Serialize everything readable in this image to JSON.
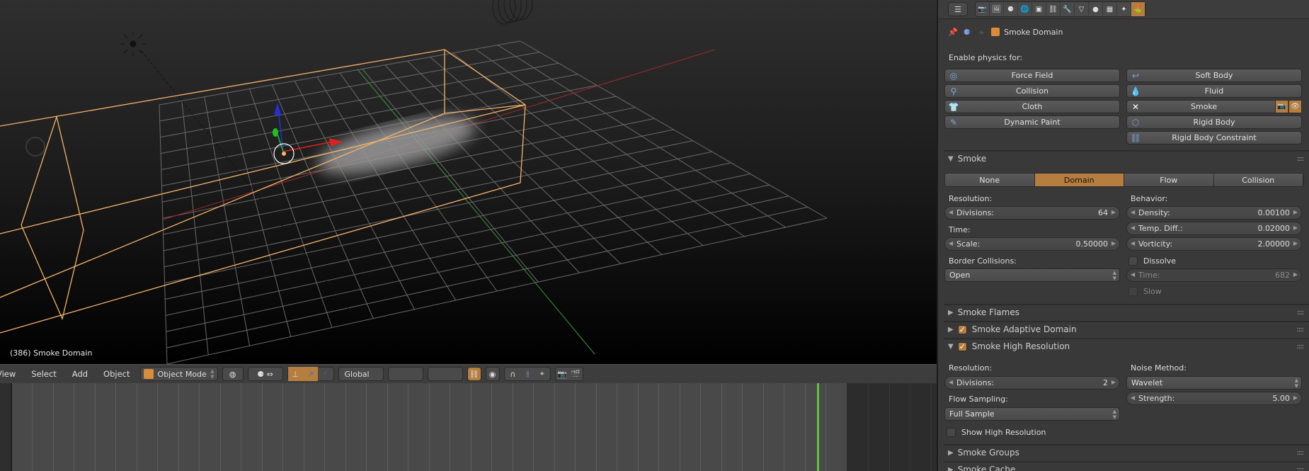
{
  "viewport": {
    "object_label": "(386) Smoke Domain",
    "menu": [
      "View",
      "Select",
      "Add",
      "Object"
    ],
    "mode": "Object Mode",
    "orientation": "Global",
    "colors": {
      "selection_outline": "#f5b46a",
      "grid": "#6a6a6a",
      "x_axis": "#a52a2a",
      "y_axis": "#3a9a3a"
    }
  },
  "timeline": {
    "current_frame_color": "#5fc43a"
  },
  "properties": {
    "breadcrumb": {
      "object": "Smoke Domain"
    },
    "context_tabs": [
      "render",
      "render-layers",
      "scene",
      "world",
      "object",
      "constraints",
      "modifiers",
      "data",
      "material",
      "texture",
      "particles",
      "physics"
    ],
    "active_tab": "physics",
    "enable_physics_label": "Enable physics for:",
    "physics_buttons_left": [
      {
        "label": "Force Field",
        "icon": "force-field-icon"
      },
      {
        "label": "Collision",
        "icon": "collision-icon"
      },
      {
        "label": "Cloth",
        "icon": "cloth-icon"
      },
      {
        "label": "Dynamic Paint",
        "icon": "dynamic-paint-icon"
      }
    ],
    "physics_buttons_right": [
      {
        "label": "Soft Body",
        "icon": "soft-body-icon"
      },
      {
        "label": "Fluid",
        "icon": "fluid-icon"
      },
      {
        "label": "Smoke",
        "icon": "close-icon"
      },
      {
        "label": "Rigid Body",
        "icon": "rigid-body-icon"
      },
      {
        "label": "Rigid Body Constraint",
        "icon": "chain-link-icon"
      }
    ],
    "smoke": {
      "title": "Smoke",
      "types": [
        "None",
        "Domain",
        "Flow",
        "Collision"
      ],
      "active_type": "Domain",
      "resolution_label": "Resolution:",
      "divisions_label": "Divisions:",
      "divisions_value": "64",
      "time_label": "Time:",
      "scale_label": "Scale:",
      "scale_value": "0.50000",
      "border_collisions_label": "Border Collisions:",
      "border_collisions_value": "Open",
      "behavior_label": "Behavior:",
      "density_label": "Density:",
      "density_value": "0.00100",
      "temp_diff_label": "Temp. Diff.:",
      "temp_diff_value": "0.02000",
      "vorticity_label": "Vorticity:",
      "vorticity_value": "2.00000",
      "dissolve_label": "Dissolve",
      "dissolve_checked": false,
      "time_field_label": "Time:",
      "time_field_value": "682",
      "slow_label": "Slow",
      "slow_checked": false
    },
    "sections": {
      "flames": "Smoke Flames",
      "adaptive": "Smoke Adaptive Domain",
      "adaptive_checked": true,
      "highres": "Smoke High Resolution",
      "highres_checked": true,
      "groups": "Smoke Groups",
      "cache": "Smoke Cache"
    },
    "highres": {
      "resolution_label": "Resolution:",
      "divisions_label": "Divisions:",
      "divisions_value": "2",
      "flow_sampling_label": "Flow Sampling:",
      "flow_sampling_value": "Full Sample",
      "noise_method_label": "Noise Method:",
      "noise_method_value": "Wavelet",
      "strength_label": "Strength:",
      "strength_value": "5.00",
      "show_high_res_label": "Show High Resolution",
      "show_high_res_checked": false
    },
    "accent_color": "#b57e3e"
  }
}
